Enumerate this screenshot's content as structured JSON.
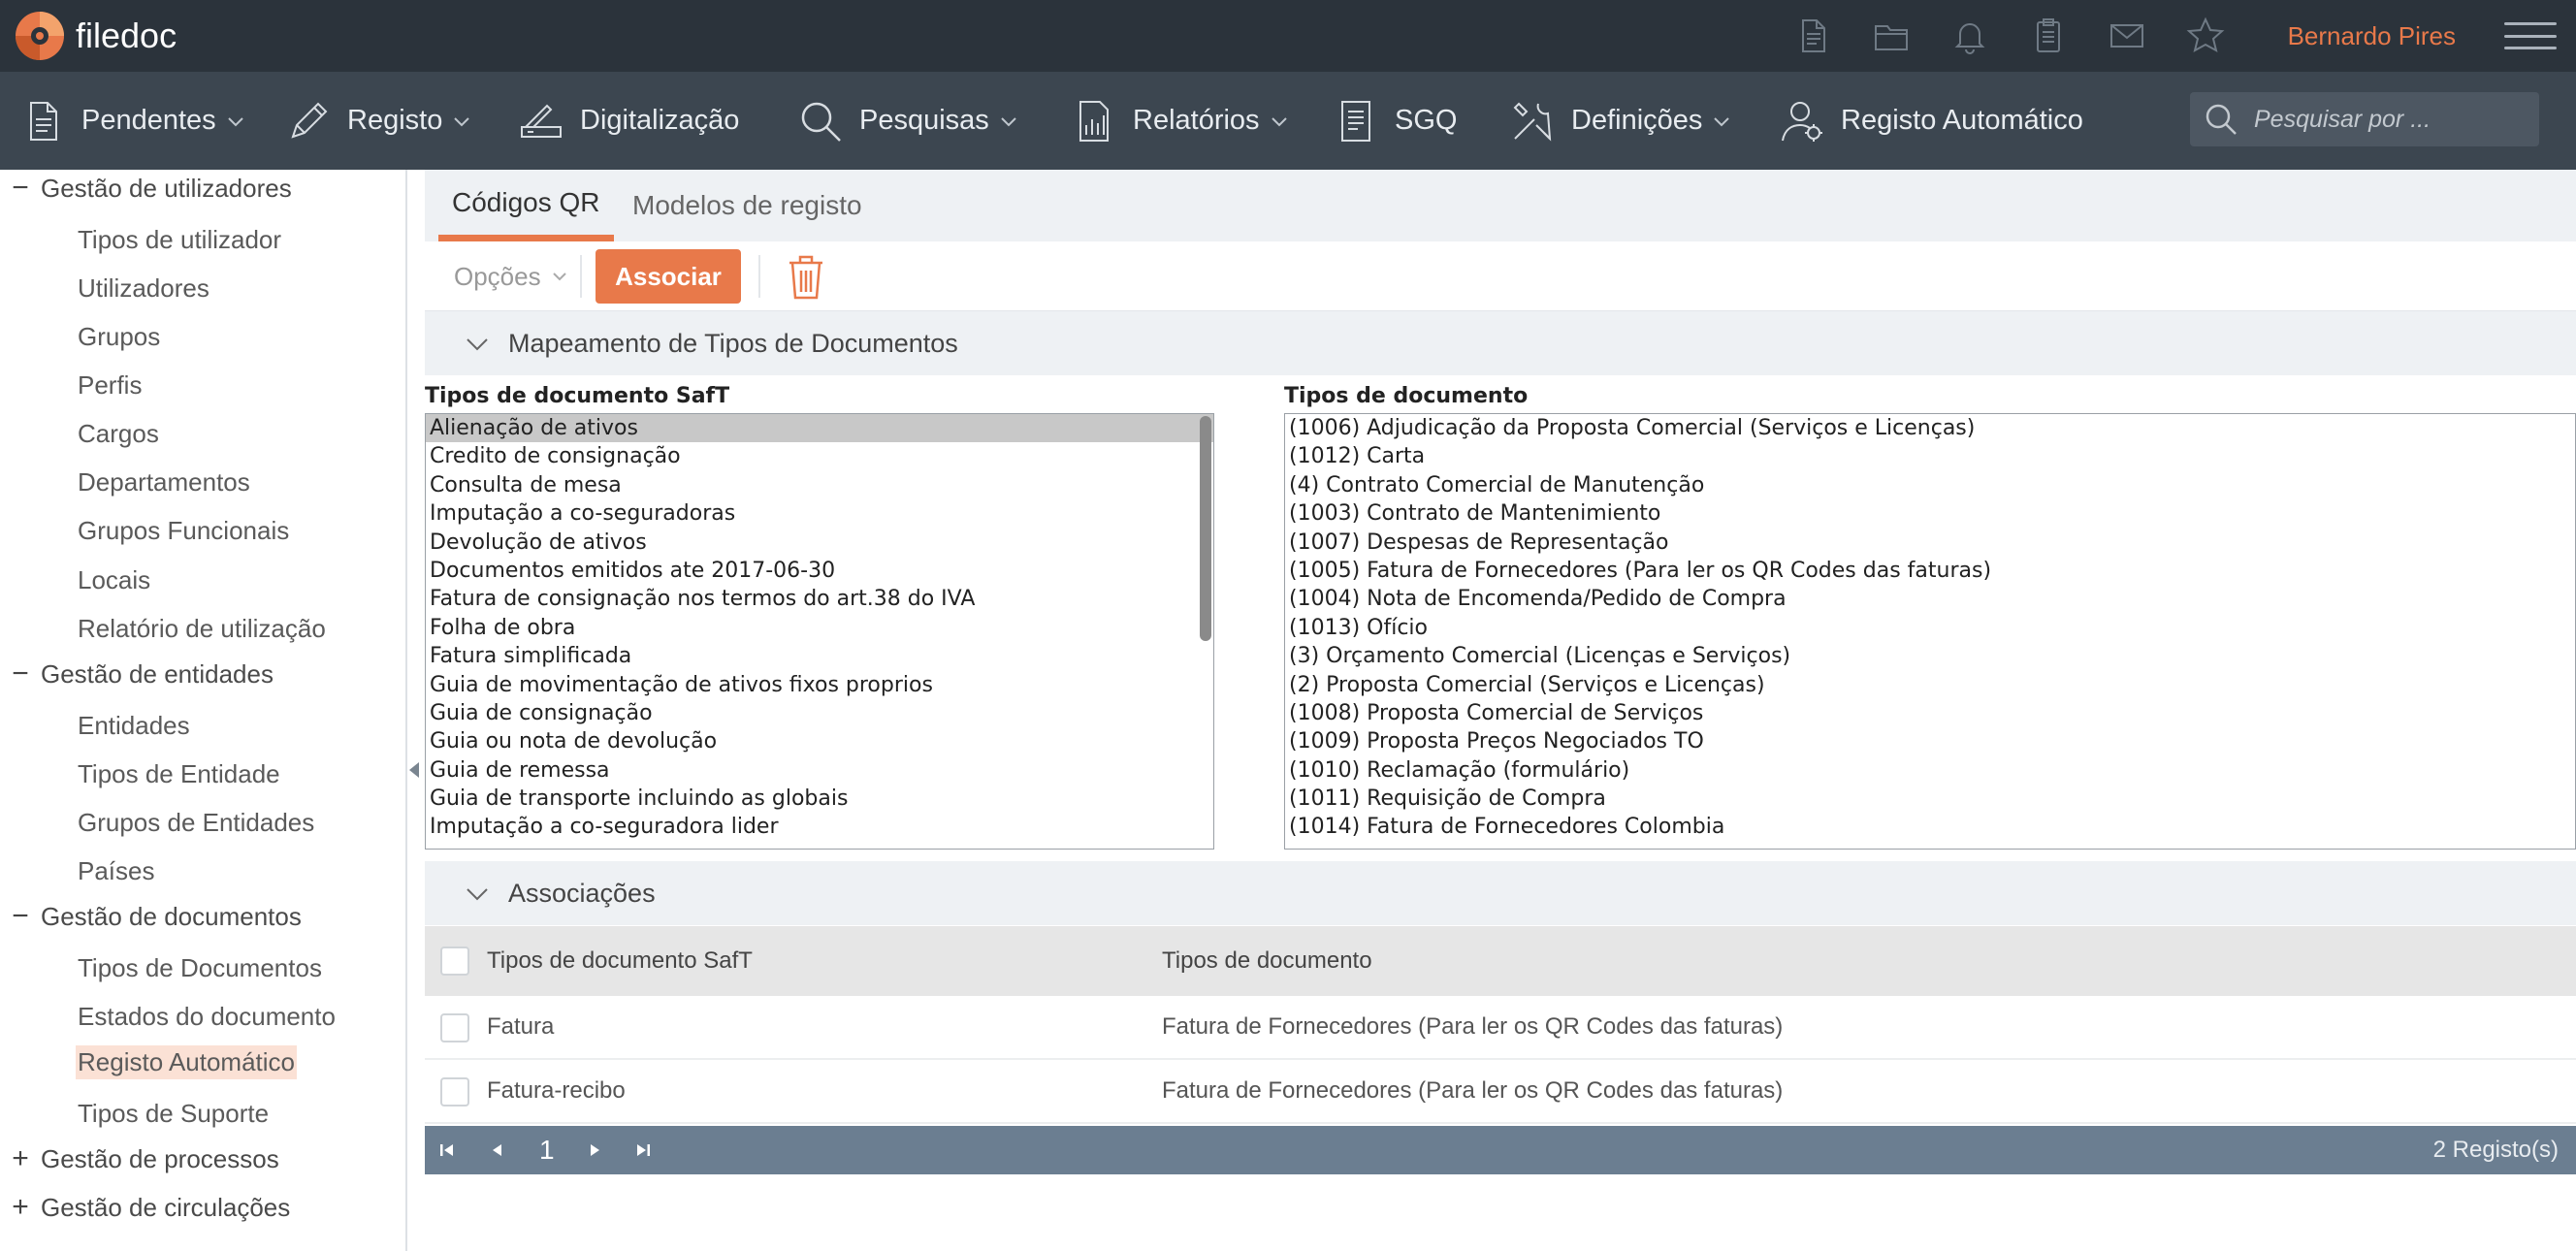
{
  "app": {
    "name": "filedoc",
    "user": "Bernardo Pires"
  },
  "top_icons": [
    "document-icon",
    "folder-icon",
    "bell-icon",
    "clipboard-icon",
    "mail-icon",
    "star-icon"
  ],
  "nav": {
    "items": [
      {
        "label": "Pendentes",
        "icon": "document-icon",
        "dropdown": true
      },
      {
        "label": "Registo",
        "icon": "pencil-icon",
        "dropdown": true
      },
      {
        "label": "Digitalização",
        "icon": "scanner-icon",
        "dropdown": false
      },
      {
        "label": "Pesquisas",
        "icon": "search-icon",
        "dropdown": true
      },
      {
        "label": "Relatórios",
        "icon": "report-icon",
        "dropdown": true
      },
      {
        "label": "SGQ",
        "icon": "list-doc-icon",
        "dropdown": false
      },
      {
        "label": "Definições",
        "icon": "tools-icon",
        "dropdown": true
      },
      {
        "label": "Registo Automático",
        "icon": "user-settings-icon",
        "dropdown": false
      }
    ],
    "search_placeholder": "Pesquisar por ..."
  },
  "sidebar": {
    "groups": [
      {
        "label": "Gestão de utilizadores",
        "toggle": "−",
        "items": [
          "Tipos de utilizador",
          "Utilizadores",
          "Grupos",
          "Perfis",
          "Cargos",
          "Departamentos",
          "Grupos Funcionais",
          "Locais",
          "Relatório de utilização"
        ]
      },
      {
        "label": "Gestão de entidades",
        "toggle": "−",
        "items": [
          "Entidades",
          "Tipos de Entidade",
          "Grupos de Entidades",
          "Países"
        ]
      },
      {
        "label": "Gestão de documentos",
        "toggle": "−",
        "items": [
          "Tipos de Documentos",
          "Estados do documento",
          "Registo Automático",
          "Tipos de Suporte"
        ]
      },
      {
        "label": "Gestão de processos",
        "toggle": "+",
        "items": []
      },
      {
        "label": "Gestão de circulações",
        "toggle": "+",
        "items": []
      }
    ],
    "active_item": "Registo Automático"
  },
  "tabs": [
    {
      "label": "Códigos QR",
      "active": true
    },
    {
      "label": "Modelos de registo",
      "active": false
    }
  ],
  "toolbar": {
    "options_label": "Opções",
    "associate_label": "Associar"
  },
  "mapping": {
    "title": "Mapeamento de Tipos de Documentos",
    "saft_label": "Tipos de documento SafT",
    "doc_label": "Tipos de documento",
    "saft_types": [
      "Alienação de ativos",
      "Credito de consignação",
      "Consulta de mesa",
      "Imputação a co-seguradoras",
      "Devolução de ativos",
      "Documentos emitidos ate 2017-06-30",
      "Fatura de consignação nos termos do art.38 do IVA",
      "Folha de obra",
      "Fatura simplificada",
      "Guia de movimentação de ativos fixos proprios",
      "Guia de consignação",
      "Guia ou nota de devolução",
      "Guia de remessa",
      "Guia de transporte incluindo as globais",
      "Imputação a co-seguradora lider"
    ],
    "saft_selected": "Alienação de ativos",
    "doc_types": [
      "(1006) Adjudicação da Proposta Comercial (Serviços e Licenças)",
      "(1012) Carta",
      "(4) Contrato Comercial de Manutenção",
      "(1003) Contrato de Mantenimiento",
      "(1007) Despesas de Representação",
      "(1005) Fatura de Fornecedores (Para ler os QR Codes das faturas)",
      "(1004) Nota de Encomenda/Pedido de Compra",
      "(1013) Ofício",
      "(3) Orçamento Comercial (Licenças e Serviços)",
      "(2) Proposta Comercial (Serviços e Licenças)",
      "(1008) Proposta Comercial de Serviços",
      "(1009) Proposta Preços Negociados TO",
      "(1010) Reclamação (formulário)",
      "(1011) Requisição de Compra",
      "(1014) Fatura de Fornecedores Colombia"
    ]
  },
  "associations": {
    "title": "Associações",
    "columns": [
      "Tipos de documento SafT",
      "Tipos de documento"
    ],
    "rows": [
      {
        "saft": "Fatura",
        "doc": "Fatura de Fornecedores (Para ler os QR Codes das faturas)"
      },
      {
        "saft": "Fatura-recibo",
        "doc": "Fatura de Fornecedores (Para ler os QR Codes das faturas)"
      }
    ],
    "page": "1",
    "count": "2 Registo(s)"
  },
  "colors": {
    "accent": "#e8794a",
    "topbar": "#2b333b",
    "navbar": "#3c4650",
    "pager": "#6b7e91"
  }
}
